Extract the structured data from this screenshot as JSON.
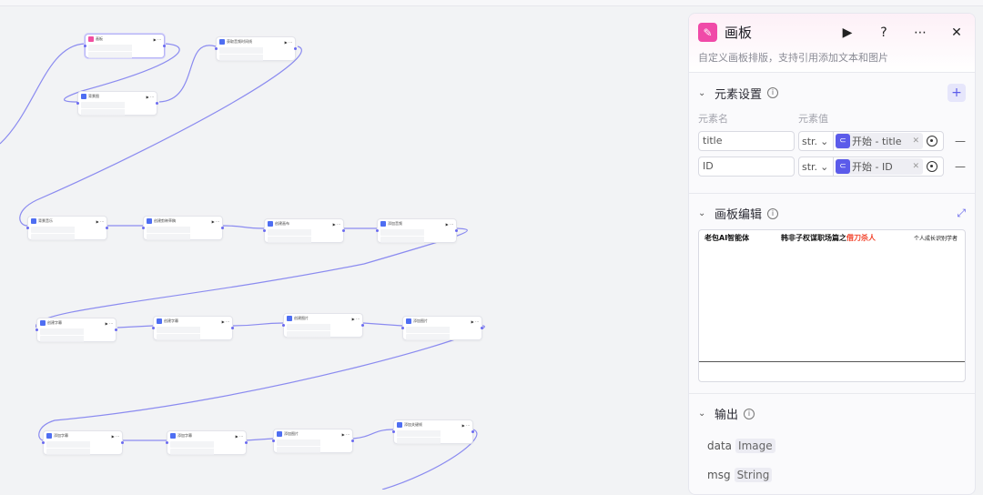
{
  "panel": {
    "title": "画板",
    "description": "自定义画板排版，支持引用添加文本和图片",
    "icons": {
      "run": "play-icon",
      "help": "question-icon",
      "more": "more-icon",
      "close": "close-icon"
    },
    "elements_section": {
      "title": "元素设置",
      "col_name": "元素名",
      "col_value": "元素值",
      "rows": [
        {
          "name": "title",
          "type": "str.",
          "ref": "开始 - title"
        },
        {
          "name": "ID",
          "type": "str.",
          "ref": "开始 - ID"
        }
      ]
    },
    "canvas_section": {
      "title": "画板编辑",
      "left_text": "老包AI智能体",
      "center_text": "韩非子权谋职场篇之",
      "center_highlight": "借刀杀人",
      "right_text": "个人成长识别学者"
    },
    "output_section": {
      "title": "输出",
      "outputs": [
        {
          "name": "data",
          "type": "Image"
        },
        {
          "name": "msg",
          "type": "String"
        }
      ]
    }
  },
  "colors": {
    "accent": "#5b5bea",
    "brand": "#f04aa8",
    "highlight": "#f2422a",
    "edge": "#8b8bf0"
  },
  "workflow": {
    "nodes": [
      {
        "title": "画板",
        "icon": "pink"
      },
      {
        "title": "获取音频时间线",
        "icon": "blue"
      },
      {
        "title": "背景图",
        "icon": "blue"
      },
      {
        "title": "背景音乐",
        "icon": "blue"
      },
      {
        "title": "创建剪映草稿",
        "icon": "blue"
      },
      {
        "title": "创建画布",
        "icon": "blue"
      },
      {
        "title": "添加音频",
        "icon": "blue"
      },
      {
        "title": "创建字幕",
        "icon": "blue"
      },
      {
        "title": "创建字幕",
        "icon": "blue"
      },
      {
        "title": "创建图片",
        "icon": "blue"
      },
      {
        "title": "添加图片",
        "icon": "blue"
      },
      {
        "title": "添加字幕",
        "icon": "blue"
      },
      {
        "title": "添加字幕",
        "icon": "blue"
      },
      {
        "title": "添加图片",
        "icon": "blue"
      },
      {
        "title": "添加关键帧",
        "icon": "blue"
      }
    ]
  }
}
